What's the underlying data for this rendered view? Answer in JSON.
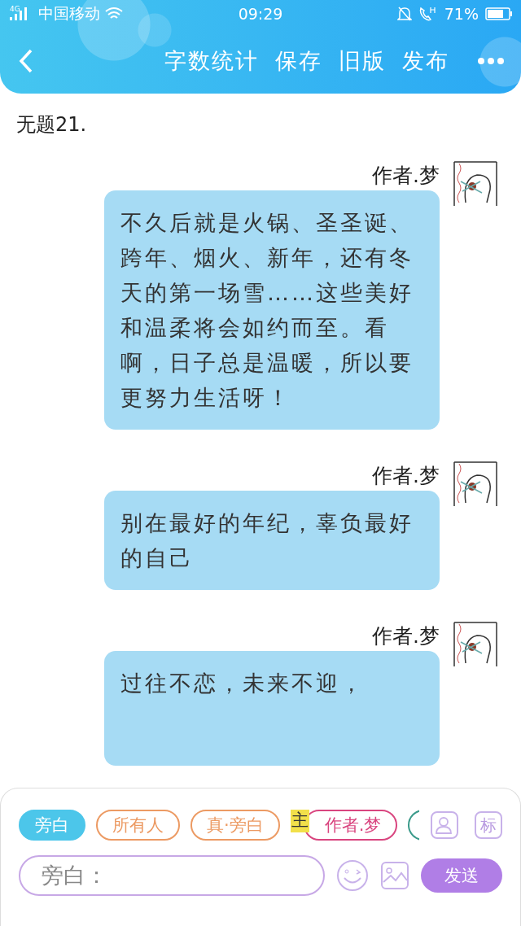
{
  "status_bar": {
    "carrier": "中国移动",
    "network": "4G",
    "time": "09:29",
    "battery": "71%"
  },
  "header": {
    "actions": [
      "字数统计",
      "保存",
      "旧版",
      "发布"
    ]
  },
  "title": "无题21.",
  "messages": [
    {
      "author": "作者.梦",
      "text": "不久后就是火锅、圣圣诞、跨年、烟火、新年，还有冬天的第一场雪……这些美好和温柔将会如约而至。看啊，日子总是温暖，所以要更努力生活呀！"
    },
    {
      "author": "作者.梦",
      "text": "别在最好的年纪，辜负最好的自己"
    },
    {
      "author": "作者.梦",
      "text": "过往不恋，未来不迎，"
    }
  ],
  "roles": [
    {
      "label": "旁白",
      "selected": true,
      "color": "#4cc6ea"
    },
    {
      "label": "所有人",
      "selected": false,
      "color": "#ec9a63"
    },
    {
      "label": "真·旁白",
      "selected": false,
      "color": "#ec9a63"
    },
    {
      "label": "作者.梦",
      "badge": "主",
      "selected": false,
      "color": "#d9457f"
    },
    {
      "selected": false,
      "color": "#3a9a8a"
    }
  ],
  "tag_button": "标",
  "input": {
    "placeholder": "旁白："
  },
  "send_button": "发送"
}
